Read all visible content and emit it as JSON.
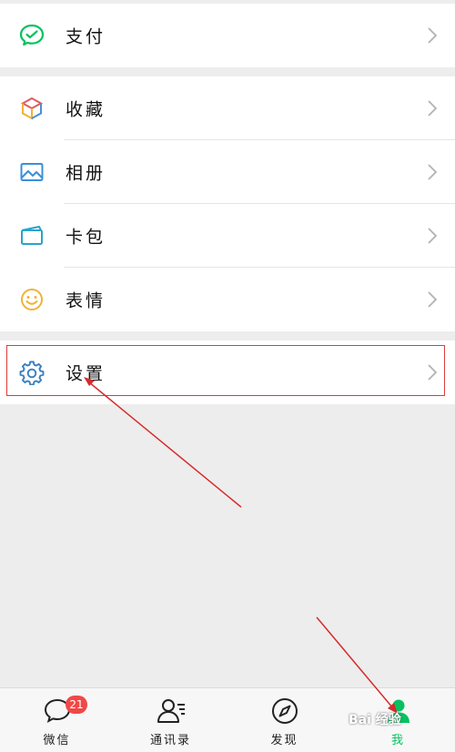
{
  "menu_top": [
    {
      "label": "支付",
      "icon": "wechat-pay-icon"
    }
  ],
  "menu_middle": [
    {
      "label": "收藏",
      "icon": "favorites-cube-icon"
    },
    {
      "label": "相册",
      "icon": "album-picture-icon"
    },
    {
      "label": "卡包",
      "icon": "card-wallet-icon"
    },
    {
      "label": "表情",
      "icon": "sticker-smile-icon"
    }
  ],
  "menu_settings": [
    {
      "label": "设置",
      "icon": "gear-icon"
    }
  ],
  "tabbar": {
    "tabs": [
      {
        "label": "微信",
        "icon": "chat-bubble-icon",
        "badge": "21"
      },
      {
        "label": "通讯录",
        "icon": "contacts-icon"
      },
      {
        "label": "发现",
        "icon": "compass-icon"
      },
      {
        "label": "我",
        "icon": "me-person-icon",
        "active": true
      }
    ]
  },
  "colors": {
    "accent_green": "#07c160",
    "badge_red": "#f04848",
    "annotation_red": "#d62b2b"
  },
  "watermark": "Bai 经验"
}
